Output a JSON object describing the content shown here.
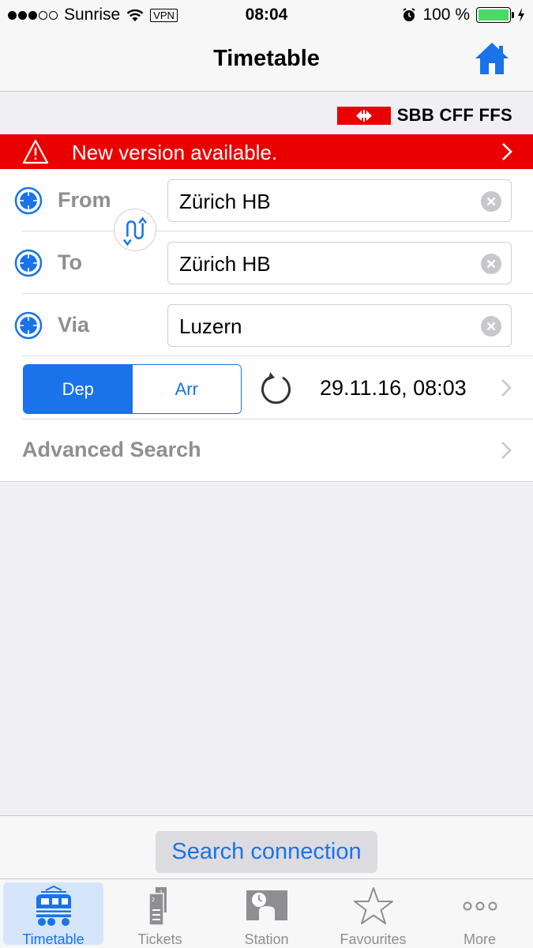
{
  "status_bar": {
    "carrier": "Sunrise",
    "vpn": "VPN",
    "time": "08:04",
    "battery": "100 %"
  },
  "nav": {
    "title": "Timetable"
  },
  "logo": {
    "text": "SBB CFF FFS"
  },
  "banner": {
    "text": "New version available."
  },
  "form": {
    "from": {
      "label": "From",
      "value": "Zürich HB"
    },
    "to": {
      "label": "To",
      "value": "Zürich HB"
    },
    "via": {
      "label": "Via",
      "value": "Luzern"
    },
    "mode": {
      "dep": "Dep",
      "arr": "Arr",
      "selected": "Dep"
    },
    "datetime": "29.11.16, 08:03",
    "advanced": "Advanced Search"
  },
  "search_button": "Search connection",
  "tabs": [
    {
      "label": "Timetable",
      "icon": "train-icon",
      "active": true
    },
    {
      "label": "Tickets",
      "icon": "tickets-icon",
      "active": false
    },
    {
      "label": "Station",
      "icon": "station-clock-icon",
      "active": false
    },
    {
      "label": "Favourites",
      "icon": "star-icon",
      "active": false
    },
    {
      "label": "More",
      "icon": "more-dots-icon",
      "active": false
    }
  ],
  "colors": {
    "accent": "#1a73e8",
    "sbb_red": "#eb0000",
    "battery_green": "#4cd964"
  }
}
